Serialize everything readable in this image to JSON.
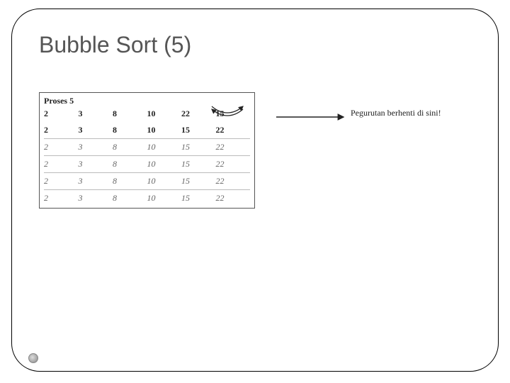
{
  "title": "Bubble Sort (5)",
  "process_label": "Proses 5",
  "rows": {
    "r0": {
      "c0": "2",
      "c1": "3",
      "c2": "8",
      "c3": "10",
      "c4": "22",
      "c5": "15"
    },
    "r1": {
      "c0": "2",
      "c1": "3",
      "c2": "8",
      "c3": "10",
      "c4": "15",
      "c5": "22"
    },
    "r2": {
      "c0": "2",
      "c1": "3",
      "c2": "8",
      "c3": "10",
      "c4": "15",
      "c5": "22"
    },
    "r3": {
      "c0": "2",
      "c1": "3",
      "c2": "8",
      "c3": "10",
      "c4": "15",
      "c5": "22"
    },
    "r4": {
      "c0": "2",
      "c1": "3",
      "c2": "8",
      "c3": "10",
      "c4": "15",
      "c5": "22"
    },
    "r5": {
      "c0": "2",
      "c1": "3",
      "c2": "8",
      "c3": "10",
      "c4": "15",
      "c5": "22"
    }
  },
  "annotation": "Pegurutan berhenti di sini!"
}
